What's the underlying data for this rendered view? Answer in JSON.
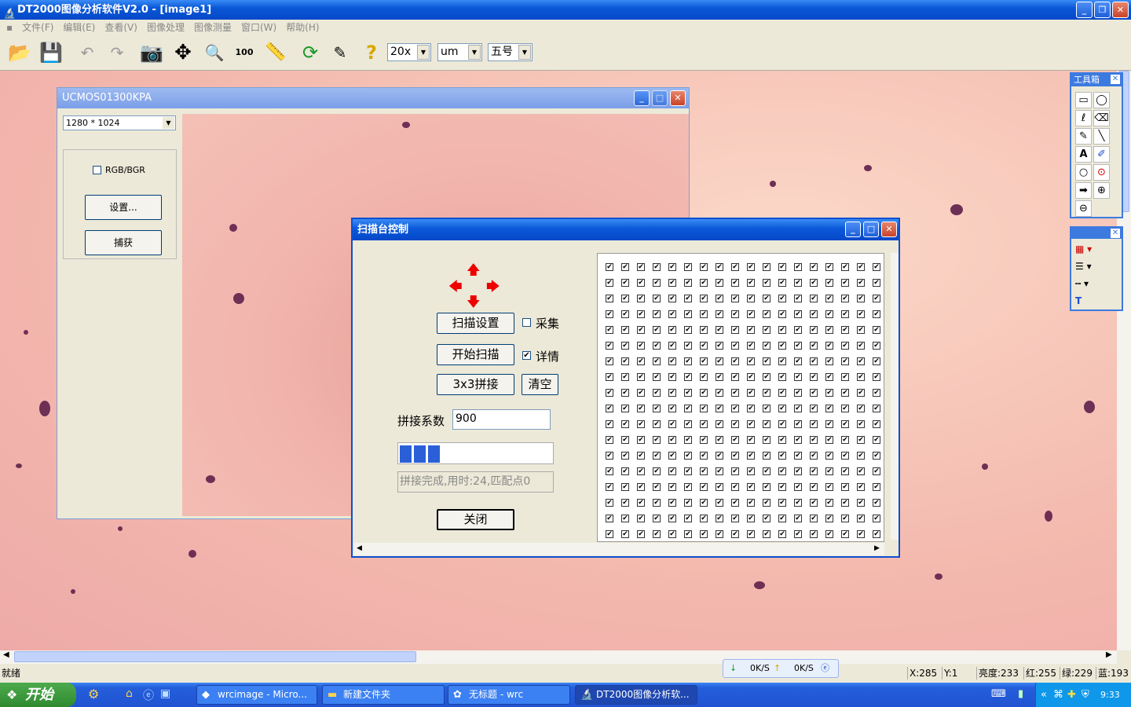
{
  "app": {
    "title": "DT2000图像分析软件V2.0 - [image1]"
  },
  "menu": [
    "文件(F)",
    "编辑(E)",
    "查看(V)",
    "图像处理",
    "图像测量",
    "窗口(W)",
    "帮助(H)"
  ],
  "toolbar": {
    "magnification": "20x",
    "unit": "um",
    "font_size": "五号",
    "ruler_label": "100"
  },
  "camera_window": {
    "title": "UCMOS01300KPA",
    "resolution": "1280 * 1024",
    "rgb_bgr_label": "RGB/BGR",
    "settings_button": "设置...",
    "capture_button": "捕获"
  },
  "scan_dialog": {
    "title": "扫描台控制",
    "scan_settings_button": "扫描设置",
    "collect_label": "采集",
    "start_scan_button": "开始扫描",
    "details_label": "详情",
    "details_checked": true,
    "stitch_button": "3x3拼接",
    "clear_button": "清空",
    "stitch_factor_label": "拼接系数",
    "stitch_factor_value": "900",
    "progress_blocks": 3,
    "status_text": "拼接完成,用时:24,匹配点0",
    "close_button": "关闭",
    "grid_columns": 18,
    "grid_rows": 18
  },
  "toolbox": {
    "title": "工具箱"
  },
  "status_bar": {
    "ready": "就绪",
    "down_speed": "0K/S",
    "up_speed": "0K/S",
    "x": "X:285",
    "y": "Y:1",
    "brightness": "亮度:233",
    "red": "红:255",
    "green": "绿:229",
    "blue": "蓝:193"
  },
  "taskbar": {
    "start": "开始",
    "tasks": [
      "wrcimage - Micro...",
      "新建文件夹",
      "无标题 - wrc",
      "DT2000图像分析软..."
    ],
    "clock": "9:33"
  }
}
